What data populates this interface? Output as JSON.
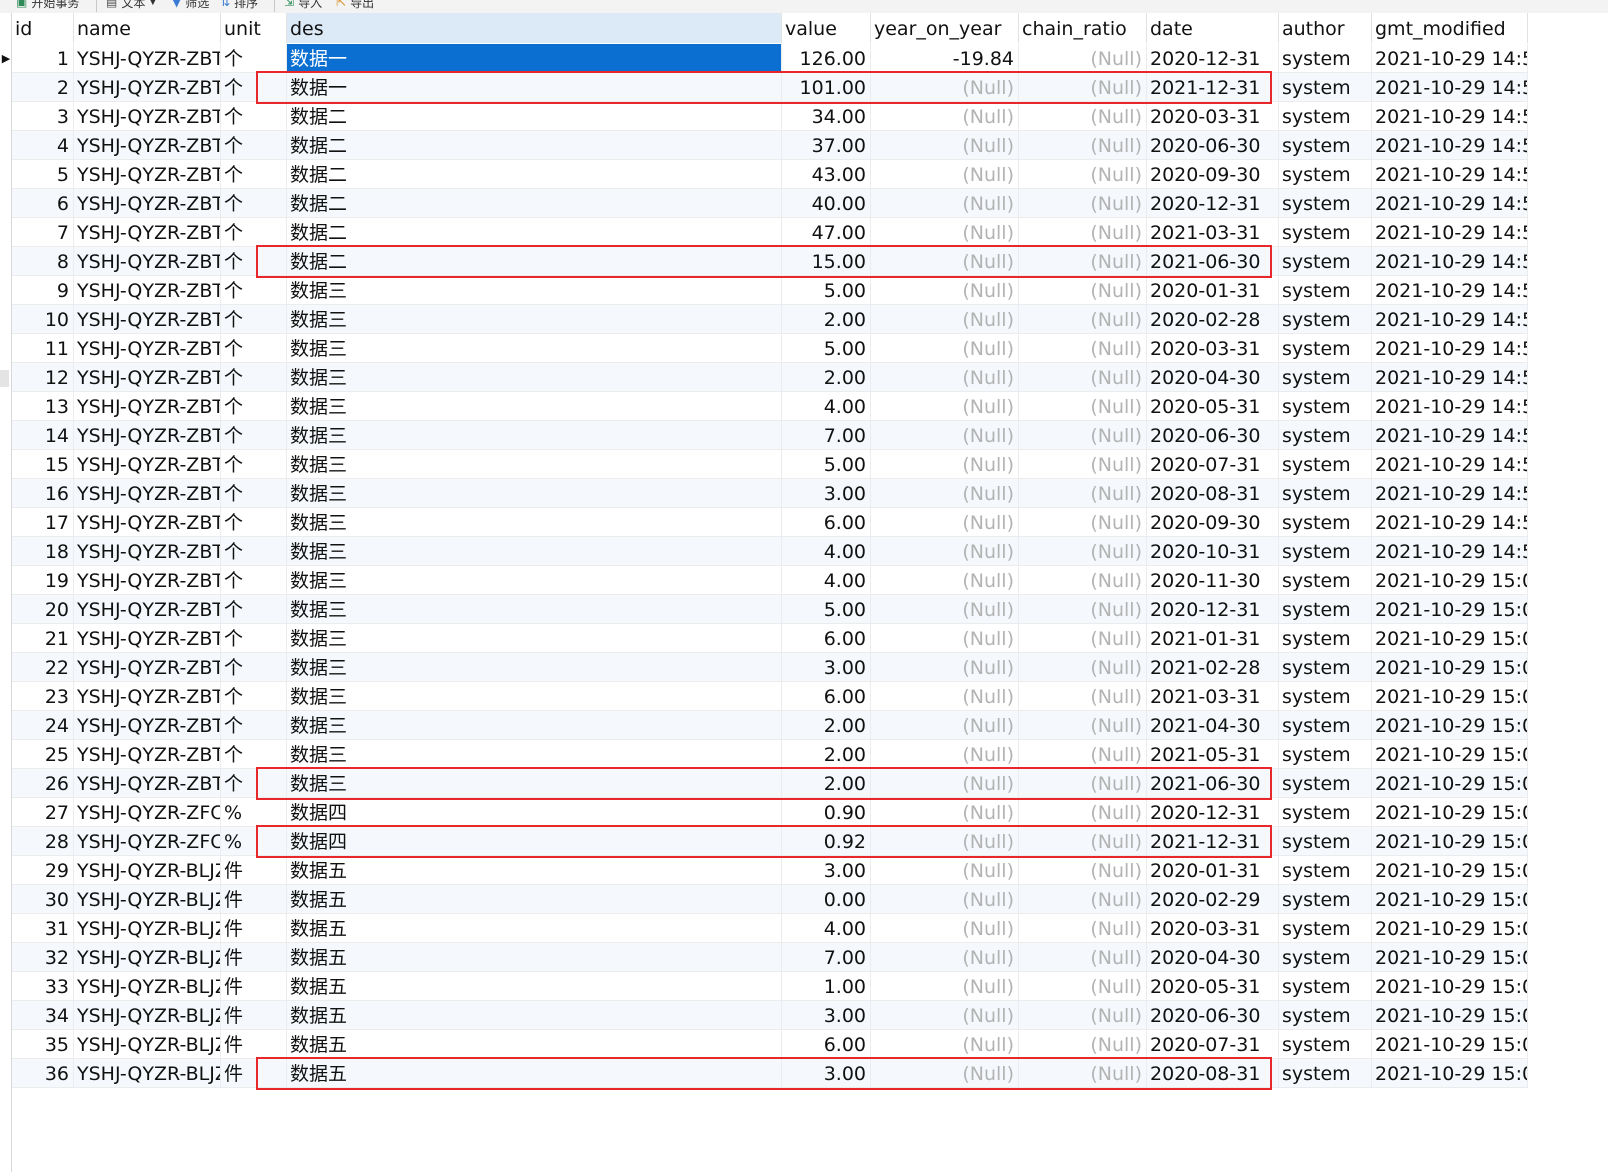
{
  "toolbar": {
    "items": [
      {
        "label": "开始事务",
        "icon": "transaction-icon"
      },
      {
        "label": "文本",
        "icon": "text-icon"
      },
      {
        "label": "筛选",
        "icon": "filter-icon"
      },
      {
        "label": "排序",
        "icon": "sort-icon"
      },
      {
        "label": "导入",
        "icon": "import-icon"
      },
      {
        "label": "导出",
        "icon": "export-icon"
      }
    ]
  },
  "columns": [
    "id",
    "name",
    "unit",
    "des",
    "value",
    "year_on_year",
    "chain_ratio",
    "date",
    "author",
    "gmt_modified"
  ],
  "null_text": "(Null)",
  "rows": [
    {
      "id": "1",
      "name": "YSHJ-QYZR-ZBT",
      "unit": "个",
      "des": "数据一",
      "value": "126.00",
      "year_on_year": "-19.84",
      "chain_ratio": "(Null)",
      "date": "2020-12-31",
      "author": "system",
      "gmt_modified": "2021-10-29 14:5"
    },
    {
      "id": "2",
      "name": "YSHJ-QYZR-ZBT",
      "unit": "个",
      "des": "数据一",
      "value": "101.00",
      "year_on_year": "(Null)",
      "chain_ratio": "(Null)",
      "date": "2021-12-31",
      "author": "system",
      "gmt_modified": "2021-10-29 14:5"
    },
    {
      "id": "3",
      "name": "YSHJ-QYZR-ZBT",
      "unit": "个",
      "des": "数据二",
      "value": "34.00",
      "year_on_year": "(Null)",
      "chain_ratio": "(Null)",
      "date": "2020-03-31",
      "author": "system",
      "gmt_modified": "2021-10-29 14:5"
    },
    {
      "id": "4",
      "name": "YSHJ-QYZR-ZBT",
      "unit": "个",
      "des": "数据二",
      "value": "37.00",
      "year_on_year": "(Null)",
      "chain_ratio": "(Null)",
      "date": "2020-06-30",
      "author": "system",
      "gmt_modified": "2021-10-29 14:5"
    },
    {
      "id": "5",
      "name": "YSHJ-QYZR-ZBT",
      "unit": "个",
      "des": "数据二",
      "value": "43.00",
      "year_on_year": "(Null)",
      "chain_ratio": "(Null)",
      "date": "2020-09-30",
      "author": "system",
      "gmt_modified": "2021-10-29 14:5"
    },
    {
      "id": "6",
      "name": "YSHJ-QYZR-ZBT",
      "unit": "个",
      "des": "数据二",
      "value": "40.00",
      "year_on_year": "(Null)",
      "chain_ratio": "(Null)",
      "date": "2020-12-31",
      "author": "system",
      "gmt_modified": "2021-10-29 14:5"
    },
    {
      "id": "7",
      "name": "YSHJ-QYZR-ZBT",
      "unit": "个",
      "des": "数据二",
      "value": "47.00",
      "year_on_year": "(Null)",
      "chain_ratio": "(Null)",
      "date": "2021-03-31",
      "author": "system",
      "gmt_modified": "2021-10-29 14:5"
    },
    {
      "id": "8",
      "name": "YSHJ-QYZR-ZBT",
      "unit": "个",
      "des": "数据二",
      "value": "15.00",
      "year_on_year": "(Null)",
      "chain_ratio": "(Null)",
      "date": "2021-06-30",
      "author": "system",
      "gmt_modified": "2021-10-29 14:5"
    },
    {
      "id": "9",
      "name": "YSHJ-QYZR-ZBT",
      "unit": "个",
      "des": "数据三",
      "value": "5.00",
      "year_on_year": "(Null)",
      "chain_ratio": "(Null)",
      "date": "2020-01-31",
      "author": "system",
      "gmt_modified": "2021-10-29 14:5"
    },
    {
      "id": "10",
      "name": "YSHJ-QYZR-ZBT",
      "unit": "个",
      "des": "数据三",
      "value": "2.00",
      "year_on_year": "(Null)",
      "chain_ratio": "(Null)",
      "date": "2020-02-28",
      "author": "system",
      "gmt_modified": "2021-10-29 14:5"
    },
    {
      "id": "11",
      "name": "YSHJ-QYZR-ZBT",
      "unit": "个",
      "des": "数据三",
      "value": "5.00",
      "year_on_year": "(Null)",
      "chain_ratio": "(Null)",
      "date": "2020-03-31",
      "author": "system",
      "gmt_modified": "2021-10-29 14:5"
    },
    {
      "id": "12",
      "name": "YSHJ-QYZR-ZBT",
      "unit": "个",
      "des": "数据三",
      "value": "2.00",
      "year_on_year": "(Null)",
      "chain_ratio": "(Null)",
      "date": "2020-04-30",
      "author": "system",
      "gmt_modified": "2021-10-29 14:5"
    },
    {
      "id": "13",
      "name": "YSHJ-QYZR-ZBT",
      "unit": "个",
      "des": "数据三",
      "value": "4.00",
      "year_on_year": "(Null)",
      "chain_ratio": "(Null)",
      "date": "2020-05-31",
      "author": "system",
      "gmt_modified": "2021-10-29 14:5"
    },
    {
      "id": "14",
      "name": "YSHJ-QYZR-ZBT",
      "unit": "个",
      "des": "数据三",
      "value": "7.00",
      "year_on_year": "(Null)",
      "chain_ratio": "(Null)",
      "date": "2020-06-30",
      "author": "system",
      "gmt_modified": "2021-10-29 14:5"
    },
    {
      "id": "15",
      "name": "YSHJ-QYZR-ZBT",
      "unit": "个",
      "des": "数据三",
      "value": "5.00",
      "year_on_year": "(Null)",
      "chain_ratio": "(Null)",
      "date": "2020-07-31",
      "author": "system",
      "gmt_modified": "2021-10-29 14:5"
    },
    {
      "id": "16",
      "name": "YSHJ-QYZR-ZBT",
      "unit": "个",
      "des": "数据三",
      "value": "3.00",
      "year_on_year": "(Null)",
      "chain_ratio": "(Null)",
      "date": "2020-08-31",
      "author": "system",
      "gmt_modified": "2021-10-29 14:5"
    },
    {
      "id": "17",
      "name": "YSHJ-QYZR-ZBT",
      "unit": "个",
      "des": "数据三",
      "value": "6.00",
      "year_on_year": "(Null)",
      "chain_ratio": "(Null)",
      "date": "2020-09-30",
      "author": "system",
      "gmt_modified": "2021-10-29 14:5"
    },
    {
      "id": "18",
      "name": "YSHJ-QYZR-ZBT",
      "unit": "个",
      "des": "数据三",
      "value": "4.00",
      "year_on_year": "(Null)",
      "chain_ratio": "(Null)",
      "date": "2020-10-31",
      "author": "system",
      "gmt_modified": "2021-10-29 14:5"
    },
    {
      "id": "19",
      "name": "YSHJ-QYZR-ZBT",
      "unit": "个",
      "des": "数据三",
      "value": "4.00",
      "year_on_year": "(Null)",
      "chain_ratio": "(Null)",
      "date": "2020-11-30",
      "author": "system",
      "gmt_modified": "2021-10-29 15:0"
    },
    {
      "id": "20",
      "name": "YSHJ-QYZR-ZBT",
      "unit": "个",
      "des": "数据三",
      "value": "5.00",
      "year_on_year": "(Null)",
      "chain_ratio": "(Null)",
      "date": "2020-12-31",
      "author": "system",
      "gmt_modified": "2021-10-29 15:0"
    },
    {
      "id": "21",
      "name": "YSHJ-QYZR-ZBT",
      "unit": "个",
      "des": "数据三",
      "value": "6.00",
      "year_on_year": "(Null)",
      "chain_ratio": "(Null)",
      "date": "2021-01-31",
      "author": "system",
      "gmt_modified": "2021-10-29 15:0"
    },
    {
      "id": "22",
      "name": "YSHJ-QYZR-ZBT",
      "unit": "个",
      "des": "数据三",
      "value": "3.00",
      "year_on_year": "(Null)",
      "chain_ratio": "(Null)",
      "date": "2021-02-28",
      "author": "system",
      "gmt_modified": "2021-10-29 15:0"
    },
    {
      "id": "23",
      "name": "YSHJ-QYZR-ZBT",
      "unit": "个",
      "des": "数据三",
      "value": "6.00",
      "year_on_year": "(Null)",
      "chain_ratio": "(Null)",
      "date": "2021-03-31",
      "author": "system",
      "gmt_modified": "2021-10-29 15:0"
    },
    {
      "id": "24",
      "name": "YSHJ-QYZR-ZBT",
      "unit": "个",
      "des": "数据三",
      "value": "2.00",
      "year_on_year": "(Null)",
      "chain_ratio": "(Null)",
      "date": "2021-04-30",
      "author": "system",
      "gmt_modified": "2021-10-29 15:0"
    },
    {
      "id": "25",
      "name": "YSHJ-QYZR-ZBT",
      "unit": "个",
      "des": "数据三",
      "value": "2.00",
      "year_on_year": "(Null)",
      "chain_ratio": "(Null)",
      "date": "2021-05-31",
      "author": "system",
      "gmt_modified": "2021-10-29 15:0"
    },
    {
      "id": "26",
      "name": "YSHJ-QYZR-ZBT",
      "unit": "个",
      "des": "数据三",
      "value": "2.00",
      "year_on_year": "(Null)",
      "chain_ratio": "(Null)",
      "date": "2021-06-30",
      "author": "system",
      "gmt_modified": "2021-10-29 15:0"
    },
    {
      "id": "27",
      "name": "YSHJ-QYZR-ZFC",
      "unit": "%",
      "des": "数据四",
      "value": "0.90",
      "year_on_year": "(Null)",
      "chain_ratio": "(Null)",
      "date": "2020-12-31",
      "author": "system",
      "gmt_modified": "2021-10-29 15:0"
    },
    {
      "id": "28",
      "name": "YSHJ-QYZR-ZFC",
      "unit": "%",
      "des": "数据四",
      "value": "0.92",
      "year_on_year": "(Null)",
      "chain_ratio": "(Null)",
      "date": "2021-12-31",
      "author": "system",
      "gmt_modified": "2021-10-29 15:0"
    },
    {
      "id": "29",
      "name": "YSHJ-QYZR-BLJZ",
      "unit": "件",
      "des": "数据五",
      "value": "3.00",
      "year_on_year": "(Null)",
      "chain_ratio": "(Null)",
      "date": "2020-01-31",
      "author": "system",
      "gmt_modified": "2021-10-29 15:0"
    },
    {
      "id": "30",
      "name": "YSHJ-QYZR-BLJZ",
      "unit": "件",
      "des": "数据五",
      "value": "0.00",
      "year_on_year": "(Null)",
      "chain_ratio": "(Null)",
      "date": "2020-02-29",
      "author": "system",
      "gmt_modified": "2021-10-29 15:0"
    },
    {
      "id": "31",
      "name": "YSHJ-QYZR-BLJZ",
      "unit": "件",
      "des": "数据五",
      "value": "4.00",
      "year_on_year": "(Null)",
      "chain_ratio": "(Null)",
      "date": "2020-03-31",
      "author": "system",
      "gmt_modified": "2021-10-29 15:0"
    },
    {
      "id": "32",
      "name": "YSHJ-QYZR-BLJZ",
      "unit": "件",
      "des": "数据五",
      "value": "7.00",
      "year_on_year": "(Null)",
      "chain_ratio": "(Null)",
      "date": "2020-04-30",
      "author": "system",
      "gmt_modified": "2021-10-29 15:0"
    },
    {
      "id": "33",
      "name": "YSHJ-QYZR-BLJZ",
      "unit": "件",
      "des": "数据五",
      "value": "1.00",
      "year_on_year": "(Null)",
      "chain_ratio": "(Null)",
      "date": "2020-05-31",
      "author": "system",
      "gmt_modified": "2021-10-29 15:0"
    },
    {
      "id": "34",
      "name": "YSHJ-QYZR-BLJZ",
      "unit": "件",
      "des": "数据五",
      "value": "3.00",
      "year_on_year": "(Null)",
      "chain_ratio": "(Null)",
      "date": "2020-06-30",
      "author": "system",
      "gmt_modified": "2021-10-29 15:0"
    },
    {
      "id": "35",
      "name": "YSHJ-QYZR-BLJZ",
      "unit": "件",
      "des": "数据五",
      "value": "6.00",
      "year_on_year": "(Null)",
      "chain_ratio": "(Null)",
      "date": "2020-07-31",
      "author": "system",
      "gmt_modified": "2021-10-29 15:0"
    },
    {
      "id": "36",
      "name": "YSHJ-QYZR-BLJZ",
      "unit": "件",
      "des": "数据五",
      "value": "3.00",
      "year_on_year": "(Null)",
      "chain_ratio": "(Null)",
      "date": "2020-08-31",
      "author": "system",
      "gmt_modified": "2021-10-29 15:0"
    }
  ],
  "selected_row_id": "1",
  "selected_column": "des",
  "highlighted_row_ids": [
    "2",
    "8",
    "26",
    "28",
    "36"
  ],
  "colors": {
    "highlight_border": "#e8272b",
    "selection": "#0b6fd1",
    "null_text": "#b3b3b3",
    "header_selected": "#dce9f7"
  }
}
